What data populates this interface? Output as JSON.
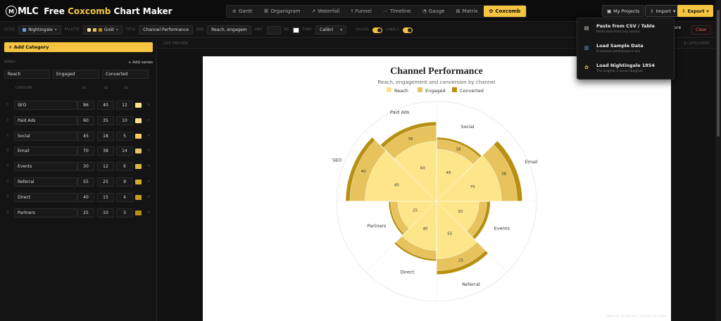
{
  "app": {
    "logo_mark": "M",
    "logo_text": "MLC",
    "title_prefix": "Free ",
    "title_highlight": "Coxcomb",
    "title_suffix": " Chart Maker"
  },
  "tabs": [
    {
      "label": "Gantt",
      "icon": "≡"
    },
    {
      "label": "Organigram",
      "icon": "⌘"
    },
    {
      "label": "Waterfall",
      "icon": "↗"
    },
    {
      "label": "Funnel",
      "icon": "⫯"
    },
    {
      "label": "Timeline",
      "icon": "⋯"
    },
    {
      "label": "Gauge",
      "icon": "◔"
    },
    {
      "label": "Matrix",
      "icon": "⊞"
    },
    {
      "label": "Coxcomb",
      "icon": "✿",
      "active": true
    }
  ],
  "top_buttons": {
    "projects": "My Projects",
    "import": "Import",
    "export": "Export"
  },
  "toolbar": {
    "style_label": "STYLE",
    "style_value": "Nightingale",
    "palette_label": "PALETTE",
    "palette_value": "Gold",
    "title_label": "TITLE",
    "title_value": "Channel Performance",
    "sub_label": "SUB",
    "sub_value": "Reach, engagem",
    "unit_label": "UNIT",
    "unit_value": "",
    "bg_label": "BG",
    "font_label": "FONT",
    "font_value": "Calibri",
    "values_label": "VALUES",
    "labels_label": "LABELS",
    "share": "Share",
    "clear": "Clear"
  },
  "left": {
    "add_category": "+ Add Category",
    "series_label": "SERIES",
    "add_series": "+ Add series",
    "series": [
      "Reach",
      "Engaged",
      "Converted"
    ],
    "cat_header": {
      "category": "CATEGORY",
      "s1": "S1",
      "s2": "S2",
      "s3": "S3"
    }
  },
  "preview": {
    "label": "LIVE PREVIEW",
    "count": "8 CATEGORIES"
  },
  "dropdown": [
    {
      "title": "Paste from CSV / Table",
      "sub": "Paste data from any source",
      "icon": "clipboard-icon",
      "glyph": "▤",
      "color": "#e8e0d0"
    },
    {
      "title": "Load Sample Data",
      "sub": "8-channel performance mix",
      "icon": "bar-chart-icon",
      "glyph": "▥",
      "color": "#6aa0e8"
    },
    {
      "title": "Load Nightingale 1854",
      "sub": "The original 3-series diagram",
      "icon": "flower-icon",
      "glyph": "✿",
      "color": "#f5c542"
    }
  ],
  "footer_note": "Made with MyLittleChart · Coxcomb Chart Maker",
  "colors": {
    "accent": "#f5c542",
    "reach": "#fde68a",
    "engaged": "#e6c35c",
    "converted": "#b8900f"
  },
  "chart_data": {
    "type": "coxcomb",
    "title": "Channel Performance",
    "subtitle": "Reach, engagement and conversion by channel",
    "legend": [
      "Reach",
      "Engaged",
      "Converted"
    ],
    "categories": [
      "Social",
      "Email",
      "Events",
      "Referral",
      "Direct",
      "Partners",
      "SEO",
      "Paid Ads"
    ],
    "series": [
      {
        "name": "Reach",
        "values": [
          45,
          70,
          30,
          55,
          40,
          25,
          85,
          60
        ]
      },
      {
        "name": "Engaged",
        "values": [
          18,
          38,
          12,
          25,
          15,
          10,
          40,
          35
        ]
      },
      {
        "name": "Converted",
        "values": [
          5,
          14,
          6,
          9,
          4,
          3,
          12,
          10
        ]
      }
    ],
    "value_labels": {
      "Reach": [
        "45",
        "70",
        "30",
        "55",
        "40",
        "25",
        "85",
        "60"
      ],
      "Engaged": [
        "18",
        "38",
        "",
        "25",
        "",
        "",
        "40",
        "35"
      ]
    },
    "max": 85
  },
  "table_rows": [
    {
      "name": "SEO",
      "v": [
        86,
        40,
        12
      ]
    },
    {
      "name": "Paid Ads",
      "v": [
        60,
        35,
        10
      ]
    },
    {
      "name": "Social",
      "v": [
        45,
        18,
        5
      ]
    },
    {
      "name": "Email",
      "v": [
        70,
        38,
        14
      ]
    },
    {
      "name": "Events",
      "v": [
        30,
        12,
        6
      ]
    },
    {
      "name": "Referral",
      "v": [
        55,
        25,
        9
      ]
    },
    {
      "name": "Direct",
      "v": [
        40,
        15,
        4
      ]
    },
    {
      "name": "Partners",
      "v": [
        25,
        10,
        3
      ]
    }
  ],
  "row_colors": [
    "#fde68a",
    "#f9e08a",
    "#f0cf60",
    "#e6c35c",
    "#ddb640",
    "#d4aa30",
    "#c99e20",
    "#b8900f"
  ]
}
